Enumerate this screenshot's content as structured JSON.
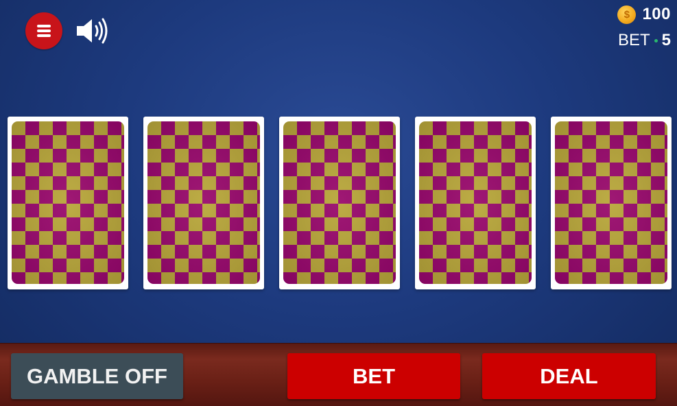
{
  "header": {
    "menu_icon": "hamburger-menu-icon",
    "sound_icon": "speaker-volume-icon",
    "coins": "100",
    "coin_icon": "coin-icon",
    "coin_symbol": "$",
    "bet_label": "BET",
    "bet_value": "5"
  },
  "cards": [
    {
      "state": "face-down"
    },
    {
      "state": "face-down"
    },
    {
      "state": "face-down"
    },
    {
      "state": "face-down"
    },
    {
      "state": "face-down"
    }
  ],
  "controls": {
    "gamble_label": "GAMBLE OFF",
    "bet_label": "BET",
    "deal_label": "DEAL"
  },
  "colors": {
    "table_blue": "#1d3a7e",
    "accent_red": "#cc0000",
    "gamble_gray": "#3c4d57",
    "card_back_magenta": "#97056d",
    "card_back_olive": "#b7a53a"
  }
}
